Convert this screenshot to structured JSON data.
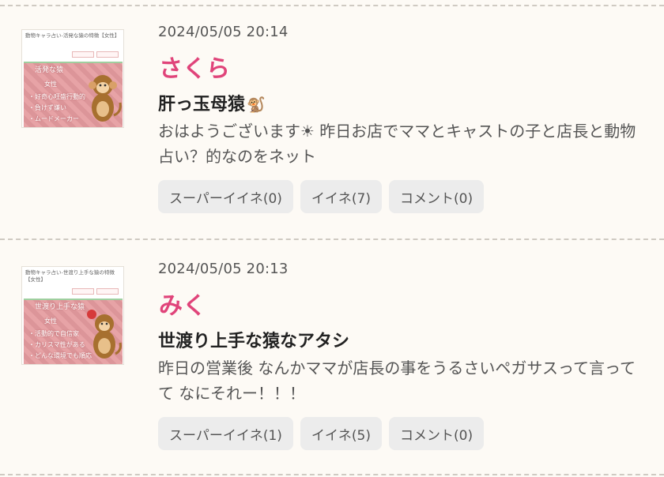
{
  "posts": [
    {
      "thumb_caption": "動物キャラ占い-活発な猿の特徴【女性】",
      "thumb_lines": [
        "活発な猿",
        "女性",
        "・好奇心旺盛行動的",
        "・負けず嫌い",
        "・ムードメーカー"
      ],
      "date": "2024/05/05 20:14",
      "name": "さくら",
      "title": "肝っ玉母猿",
      "title_icon": "🐒",
      "body": "おはようございます☀︎ 昨日お店でママとキャストの子と店長と動物占い？的なのをネット",
      "buttons": [
        "スーパーイイネ(0)",
        "イイネ(7)",
        "コメント(0)"
      ]
    },
    {
      "thumb_caption": "動物キャラ占い-世渡り上手な猿の特徴【女性】",
      "thumb_lines": [
        "世渡り上手な猿",
        "女性",
        "・活動的で自信家",
        "・カリスマ性がある",
        "・どんな環境でも順応"
      ],
      "date": "2024/05/05 20:13",
      "name": "みく",
      "title": "世渡り上手な猿なアタシ",
      "title_icon": "",
      "body": "昨日の営業後 なんかママが店長の事をうるさいペガサスって言ってて なにそれー！！！",
      "buttons": [
        "スーパーイイネ(1)",
        "イイネ(5)",
        "コメント(0)"
      ]
    }
  ]
}
